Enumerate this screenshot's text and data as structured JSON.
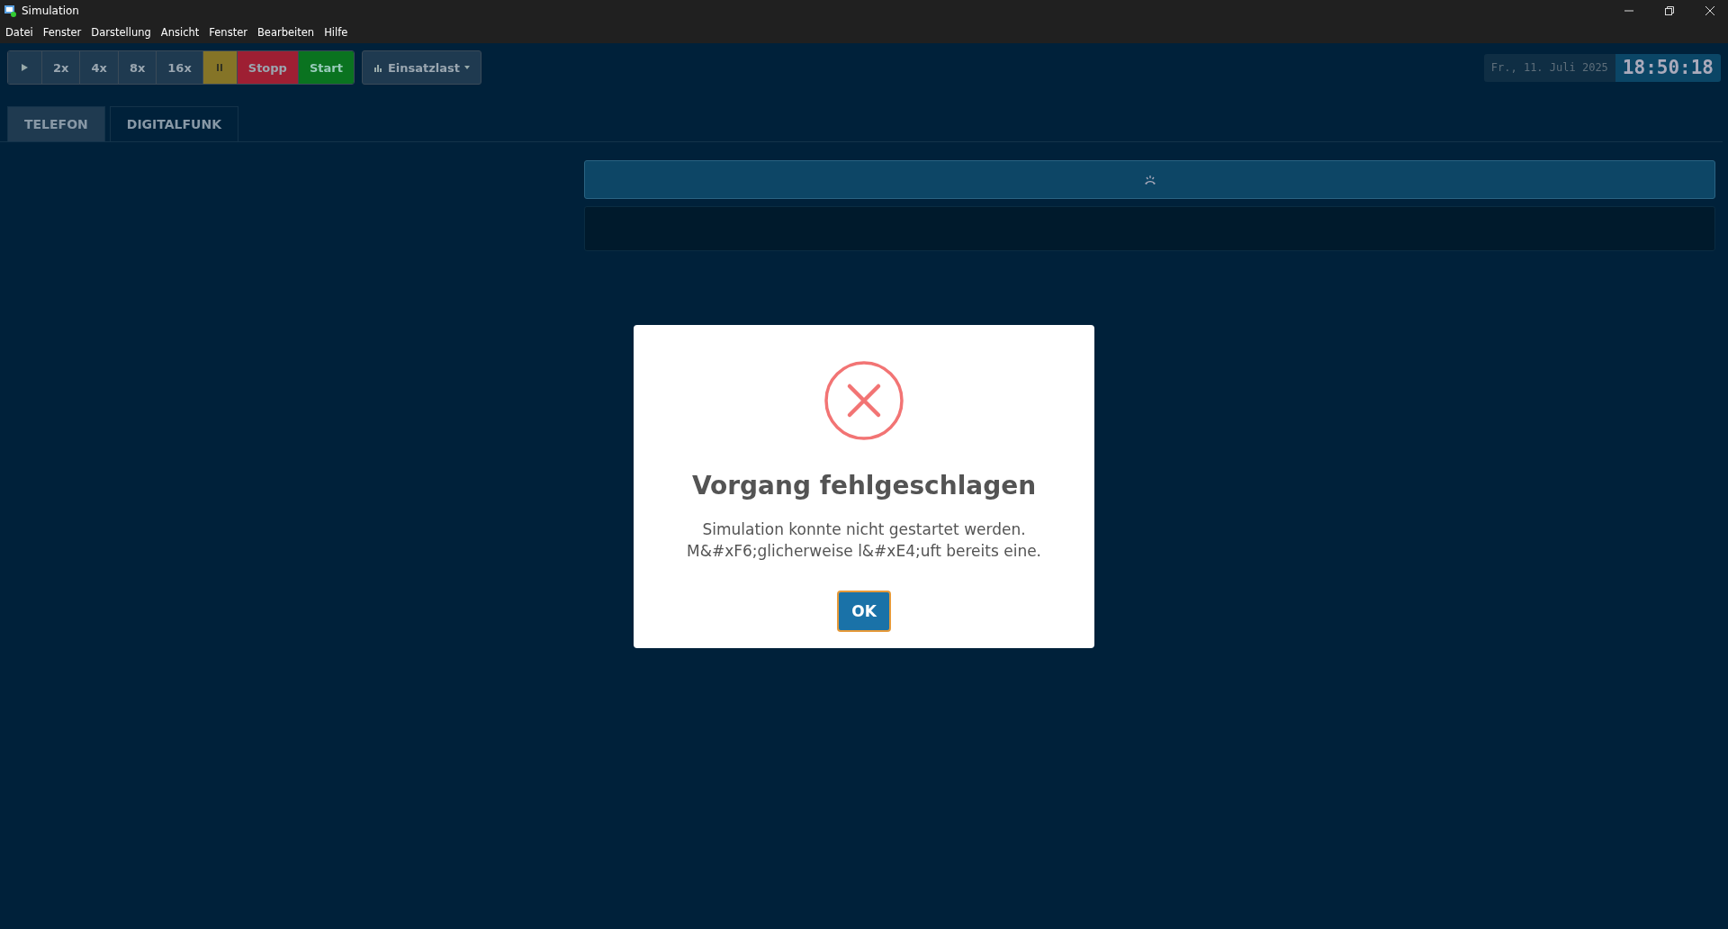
{
  "window": {
    "title": "Simulation"
  },
  "menu": [
    "Datei",
    "Fenster",
    "Darstellung",
    "Ansicht",
    "Fenster",
    "Bearbeiten",
    "Hilfe"
  ],
  "toolbar": [
    {
      "kind": "play"
    },
    {
      "kind": "speed",
      "label": "2x"
    },
    {
      "kind": "speed",
      "label": "4x"
    },
    {
      "kind": "speed",
      "label": "8x"
    },
    {
      "kind": "speed",
      "label": "16x"
    },
    {
      "kind": "pause"
    },
    {
      "kind": "stop",
      "label": "Stopp"
    },
    {
      "kind": "start",
      "label": "Start"
    }
  ],
  "load_dropdown": {
    "label": "Einsatzlast"
  },
  "clock": {
    "date": "Fr., 11. Juli 2025",
    "time": "18:50:18"
  },
  "tabs": [
    {
      "label": "TELEFON",
      "selected": true
    },
    {
      "label": "DIGITALFUNK",
      "selected": false
    }
  ],
  "dialog": {
    "kind": "error",
    "title": "Vorgang fehlgeschlagen",
    "message": [
      "Simulation konnte nicht gestartet werden.",
      "M&#xF6;glicherweise l&#xE4;uft bereits eine."
    ],
    "button": "OK"
  }
}
